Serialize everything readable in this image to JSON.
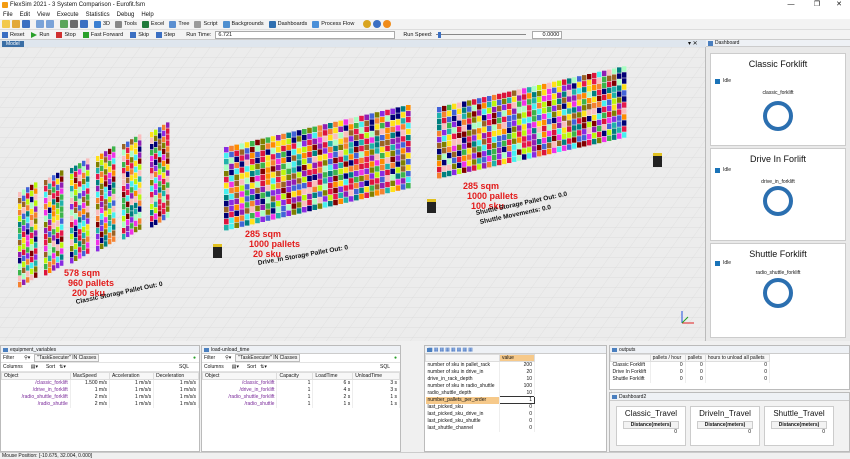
{
  "window": {
    "title": "FlexSim 2021 - 3 System Comparison - Eurofit.fsm",
    "controls": [
      "—",
      "❐",
      "✕"
    ]
  },
  "menu": [
    "File",
    "Edit",
    "View",
    "Execute",
    "Statistics",
    "Debug",
    "Help"
  ],
  "toolbar": {
    "items": [
      "3D",
      "Tools",
      "Excel",
      "Tree",
      "Script",
      "Backgrounds",
      "Dashboards",
      "Process Flow"
    ]
  },
  "runbar": {
    "reset": "Reset",
    "run": "Run",
    "stop": "Stop",
    "fast_forward": "Fast Forward",
    "skip": "Skip",
    "step": "Step",
    "run_time_label": "Run Time:",
    "run_time_value": "6.721",
    "run_speed_label": "Run Speed:",
    "run_speed_value": "0.0000"
  },
  "model_tab": "Model",
  "viewport": {
    "classic": {
      "l1": "578 sqm",
      "l2": "960 pallets",
      "l3": "200 sku",
      "note": "Classic Storage Pallet Out: 0"
    },
    "drivein": {
      "l1": "285 sqm",
      "l2": "1000 pallets",
      "l3": "20 sku",
      "note": "Drive_In Storage Pallet Out: 0"
    },
    "shuttle": {
      "l1": "285 sqm",
      "l2": "1000 pallets",
      "l3": "100 sku",
      "note1": "Shuttle Storage Pallet Out: 0.0",
      "note2": "Shuttle Movements: 0.0"
    }
  },
  "dashboard": {
    "tab": "Dashboard",
    "cards": [
      {
        "title": "Classic Forklift",
        "legend": "Idle",
        "label": "classic_forklift"
      },
      {
        "title": "Drive In Forlift",
        "legend": "Idle",
        "label": "drive_in_forklift"
      },
      {
        "title": "Shuttle Forklift",
        "legend": "Idle",
        "label": "radio_shuttle_forklift"
      }
    ]
  },
  "equipment": {
    "tab": "equipment_variables",
    "filter_label": "Filter",
    "chip": "\"TaskExecuter\" IN Classes",
    "columns_label": "Columns",
    "sort_label": "Sort",
    "sql_label": "SQL",
    "headers": [
      "Object",
      "MaxSpeed",
      "Acceleration",
      "Deceleration"
    ],
    "rows": [
      [
        "/classic_forklift",
        "1.500 m/s",
        "1 m/s/s",
        "1 m/s/s"
      ],
      [
        "/drive_in_forklift",
        "1 m/s",
        "1 m/s/s",
        "1 m/s/s"
      ],
      [
        "/radio_shuttle_forklift",
        "2 m/s",
        "1 m/s/s",
        "1 m/s/s"
      ],
      [
        "/radio_shuttle",
        "2 m/s",
        "1 m/s/s",
        "1 m/s/s"
      ]
    ]
  },
  "load": {
    "tab": "load-unload_time",
    "filter_label": "Filter",
    "chip": "\"TaskExecuter\" IN Classes",
    "columns_label": "Columns",
    "sort_label": "Sort",
    "sql_label": "SQL",
    "headers": [
      "Object",
      "Capacity",
      "LoadTime",
      "UnloadTime"
    ],
    "rows": [
      [
        "/classic_forklift",
        "1",
        "6 s",
        "3 s"
      ],
      [
        "/drive_in_forklift",
        "1",
        "4 s",
        "3 s"
      ],
      [
        "/radio_shuttle_forklift",
        "1",
        "2 s",
        "1 s"
      ],
      [
        "/radio_shuttle",
        "1",
        "1 s",
        "1 s"
      ]
    ]
  },
  "params": {
    "value_header": "value",
    "rows": [
      [
        "number of sku in pallet_rack",
        "200"
      ],
      [
        "number of sku in drive_in",
        "20"
      ],
      [
        "drive_in_rack_depth",
        "10"
      ],
      [
        "number of sku in radio_shuttle",
        "100"
      ],
      [
        "radio_shuttle_depth",
        "10"
      ],
      [
        "number_pallets_per_order",
        "1"
      ],
      [
        "last_picked_sku",
        "0"
      ],
      [
        "last_picked_sku_drive_in",
        "0"
      ],
      [
        "last_picked_sku_shuttle",
        "0"
      ],
      [
        "last_shuttle_channel",
        "0"
      ]
    ]
  },
  "outputs": {
    "tab": "outputs",
    "headers": [
      "",
      "pallets / hour",
      "pallets",
      "hours to unload all pallets"
    ],
    "rows": [
      [
        "Classic Forklift",
        "0",
        "0",
        "0"
      ],
      [
        "Drive In Forklift",
        "0",
        "0",
        "0"
      ],
      [
        "Shuttle Forklift",
        "0",
        "0",
        "0"
      ]
    ]
  },
  "dashboard2": {
    "tab": "Dashboard2",
    "cards": [
      {
        "title": "Classic_Travel",
        "col": "Distance(meters)",
        "value": "0"
      },
      {
        "title": "DriveIn_Travel",
        "col": "Distance(meters)",
        "value": "0"
      },
      {
        "title": "Shuttle_Travel",
        "col": "Distance(meters)",
        "value": "0"
      }
    ]
  },
  "status": "Mouse Position: [-10.675, 32.004, 0.000]",
  "colors": {
    "accent": "#3a6ea5",
    "red_text": "#e31b1b",
    "ring": "#2b6fb0"
  }
}
